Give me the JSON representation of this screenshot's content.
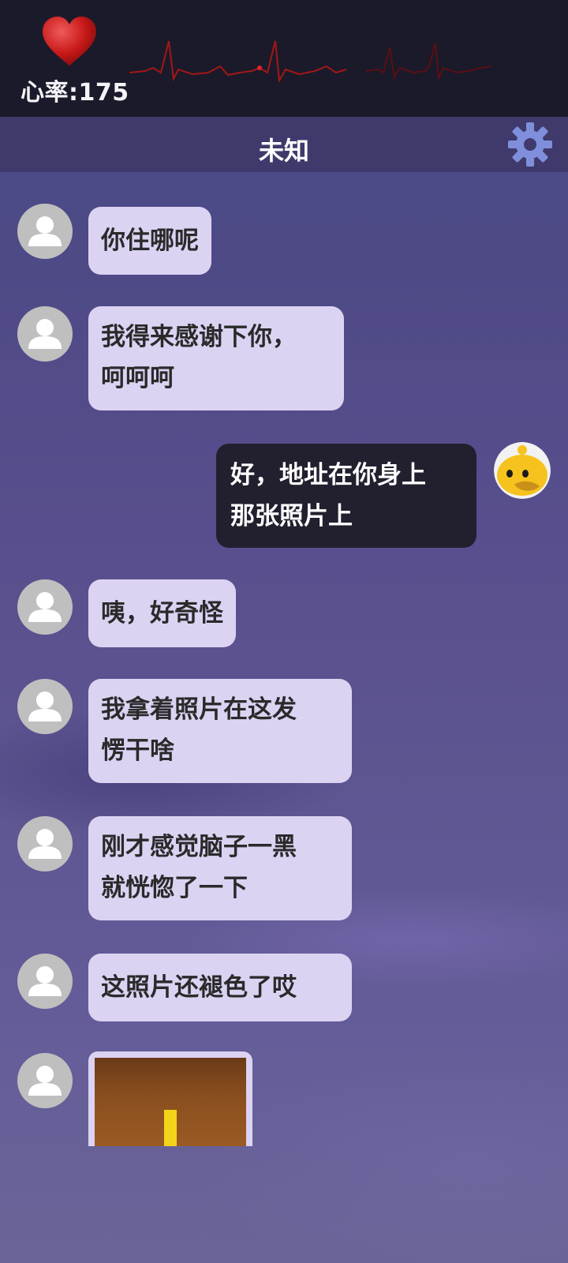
{
  "header": {
    "heart_rate_label": "心率:175",
    "icons": {
      "heart": "heart-icon",
      "ecg": "ecg-line-icon"
    },
    "colors": {
      "panel": "#1b1a2a",
      "heart": "#c71818",
      "ecg": "#9a1616"
    }
  },
  "title_bar": {
    "title": "未知",
    "settings_icon": "gear-icon",
    "colors": {
      "bar": "#3f3a6b",
      "gear": "#7f8fdc"
    }
  },
  "messages": [
    {
      "sender": "other",
      "lines": [
        "你住哪呢"
      ]
    },
    {
      "sender": "other",
      "lines": [
        "我得来感谢下你，",
        "呵呵呵"
      ]
    },
    {
      "sender": "self",
      "lines": [
        "好，地址在你身上",
        "那张照片上"
      ]
    },
    {
      "sender": "other",
      "lines": [
        "咦，好奇怪"
      ]
    },
    {
      "sender": "other",
      "lines": [
        "我拿着照片在这发",
        "愣干啥"
      ]
    },
    {
      "sender": "other",
      "lines": [
        "刚才感觉脑子一黑",
        "就恍惚了一下"
      ]
    },
    {
      "sender": "other",
      "lines": [
        "这照片还褪色了哎"
      ]
    },
    {
      "sender": "other",
      "type": "image",
      "image": "faded-photo"
    }
  ],
  "colors": {
    "other_bubble": "#dcd3f3",
    "self_bubble": "#22202f",
    "avatar_placeholder": "#bfbfbf"
  }
}
